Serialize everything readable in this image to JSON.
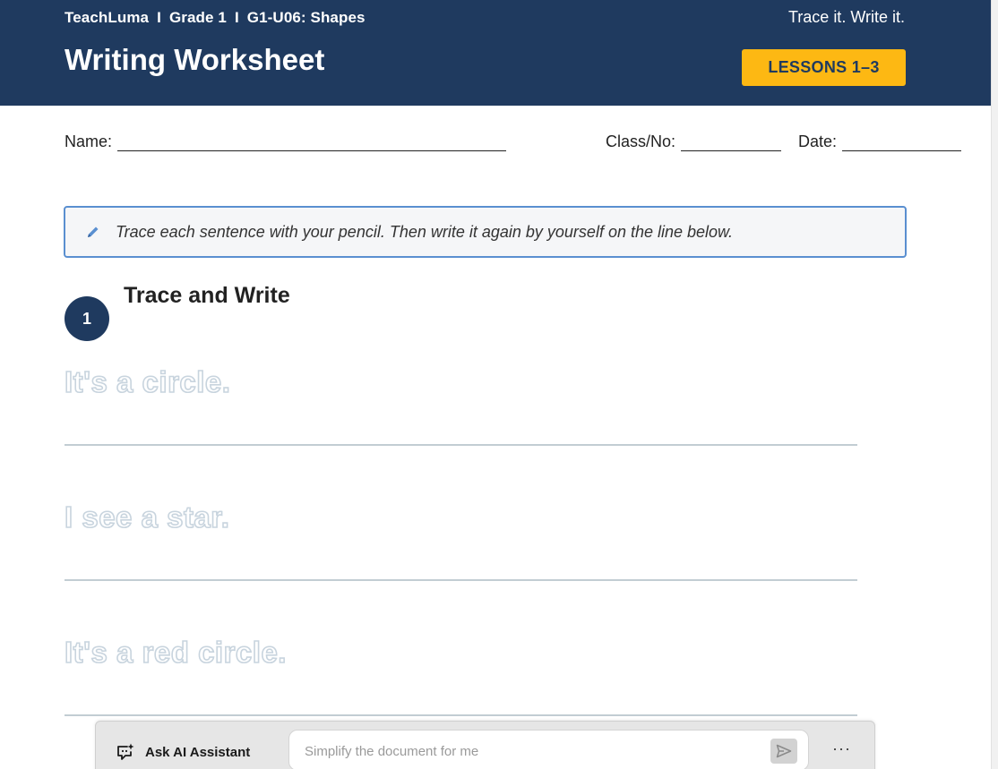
{
  "header": {
    "brand": "TeachLuma",
    "separator": "I",
    "grade": "Grade 1",
    "unit": "G1-U06: Shapes",
    "tagline": "Trace it. Write it.",
    "title": "Writing Worksheet",
    "badge": "LESSONS 1–3"
  },
  "student_info": {
    "name_label": "Name:",
    "class_label": "Class/No:",
    "date_label": "Date:"
  },
  "instruction": {
    "icon": "pencil-icon",
    "text": "Trace each sentence with your pencil. Then write it again by yourself on the line below."
  },
  "section": {
    "number": "1",
    "title": "Trace and Write"
  },
  "sentences": [
    "It's a circle.",
    "I see a star.",
    "It's a red circle."
  ],
  "ai_assistant": {
    "label": "Ask AI Assistant",
    "placeholder": "Simplify the document for me",
    "more": "···"
  },
  "colors": {
    "header_bg": "#1f3a5f",
    "badge_bg": "#fdb813",
    "instruction_border": "#5a8fd0",
    "trace_outline": "#c8d4de"
  }
}
